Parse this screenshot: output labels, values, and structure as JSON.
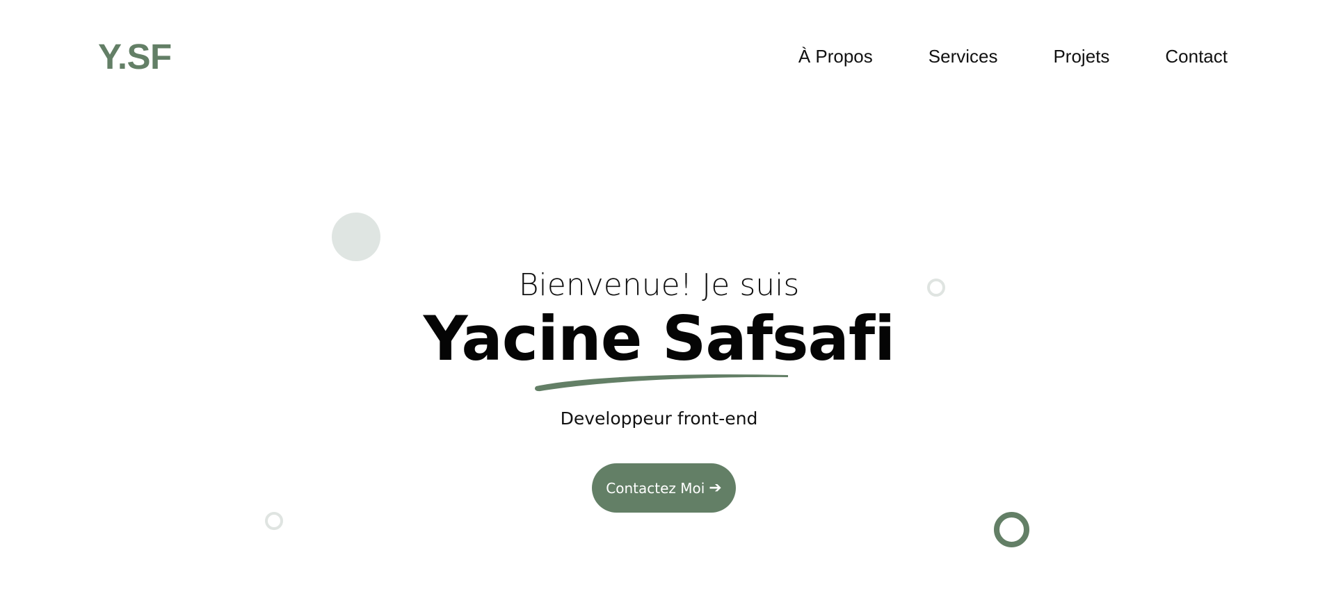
{
  "header": {
    "logo": "Y.SF",
    "nav": [
      {
        "label": "À Propos"
      },
      {
        "label": "Services"
      },
      {
        "label": "Projets"
      },
      {
        "label": "Contact"
      }
    ]
  },
  "hero": {
    "greeting": "Bienvenue! Je suis",
    "name": "Yacine Safsafi",
    "role": "Developpeur front-end",
    "cta_label": "Contactez Moi",
    "cta_icon": "arrow-right-icon"
  },
  "colors": {
    "accent": "#637f66",
    "decor_light": "#dfe5e2",
    "background": "#ffffff"
  }
}
